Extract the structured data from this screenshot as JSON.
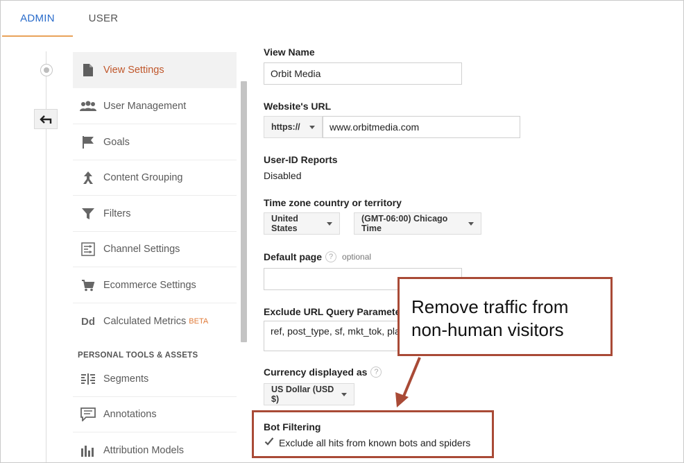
{
  "tabs": [
    {
      "label": "ADMIN",
      "active": true
    },
    {
      "label": "USER",
      "active": false
    }
  ],
  "nav": {
    "items": [
      {
        "label": "View Settings",
        "icon": "document-icon",
        "active": true
      },
      {
        "label": "User Management",
        "icon": "people-icon"
      },
      {
        "label": "Goals",
        "icon": "flag-icon"
      },
      {
        "label": "Content Grouping",
        "icon": "grouping-icon"
      },
      {
        "label": "Filters",
        "icon": "filter-icon"
      },
      {
        "label": "Channel Settings",
        "icon": "channel-settings-icon"
      },
      {
        "label": "Ecommerce Settings",
        "icon": "cart-icon"
      },
      {
        "label": "Calculated Metrics",
        "icon": "dd-icon",
        "badge": "BETA"
      }
    ],
    "section_heading": "PERSONAL TOOLS & ASSETS",
    "personal_items": [
      {
        "label": "Segments",
        "icon": "segments-icon"
      },
      {
        "label": "Annotations",
        "icon": "annotation-icon"
      },
      {
        "label": "Attribution Models",
        "icon": "bar-chart-icon"
      }
    ],
    "dd_icon_text": "Dd"
  },
  "form": {
    "view_name": {
      "label": "View Name",
      "value": "Orbit Media"
    },
    "website_url": {
      "label": "Website's URL",
      "protocol": "https://",
      "value": "www.orbitmedia.com"
    },
    "user_id": {
      "label": "User-ID Reports",
      "value": "Disabled"
    },
    "timezone": {
      "label": "Time zone country or territory",
      "country": "United States",
      "zone": "(GMT-06:00) Chicago Time"
    },
    "default_page": {
      "label": "Default page",
      "help": "?",
      "optional": "optional",
      "value": ""
    },
    "exclude_params": {
      "label": "Exclude URL Query Parameters",
      "value": "ref, post_type, sf, mkt_tok, pla"
    },
    "currency": {
      "label": "Currency displayed as",
      "help": "?",
      "value": "US Dollar (USD $)"
    },
    "bot_filtering": {
      "label": "Bot Filtering",
      "checkbox_label": "Exclude all hits from known bots and spiders",
      "checked": true
    }
  },
  "callout": {
    "line1": "Remove traffic from",
    "line2": "non-human visitors"
  },
  "colors": {
    "accent_blue": "#2a6ccb",
    "active_nav": "#c0572b",
    "callout_border": "#a94a36",
    "tab_underline": "#e8a259"
  }
}
